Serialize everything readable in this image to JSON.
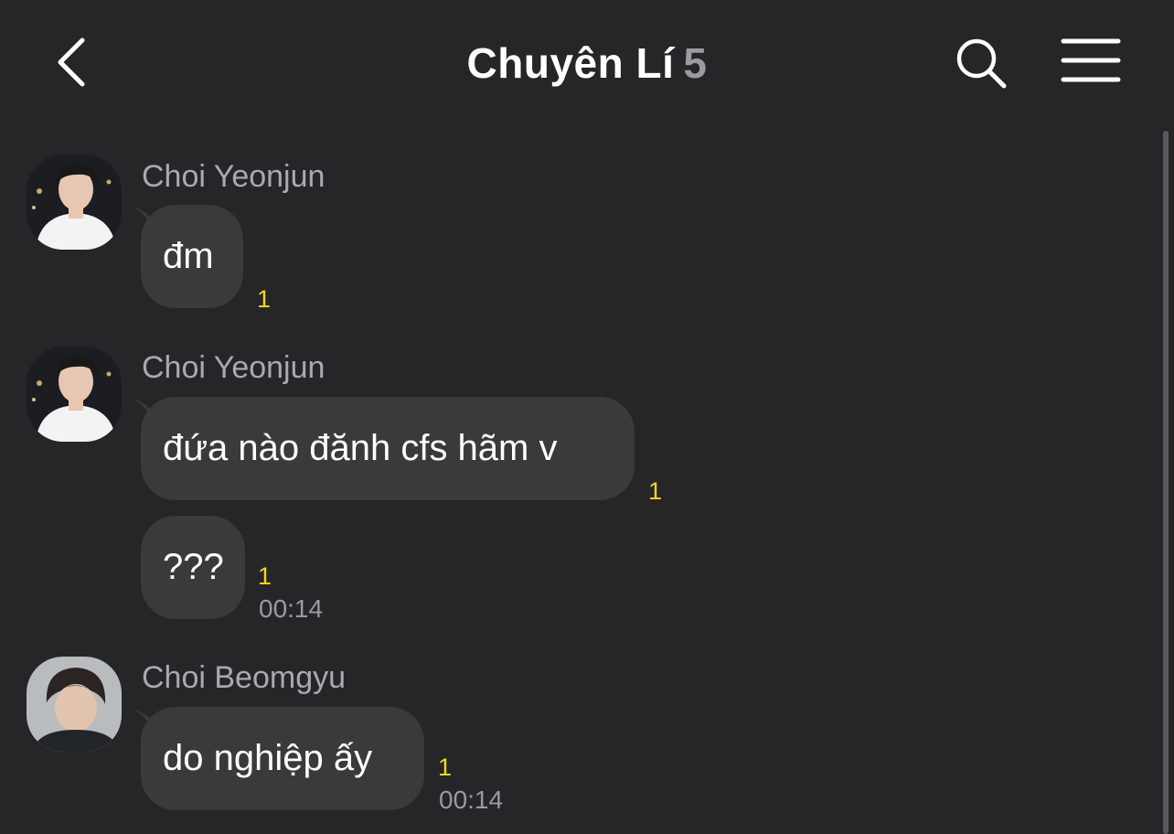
{
  "header": {
    "title": "Chuyên Lí",
    "member_count": "5"
  },
  "messages": [
    {
      "sender": "Choi Yeonjun",
      "text": "đm",
      "unread": "1",
      "time": ""
    },
    {
      "sender": "Choi Yeonjun",
      "text": "đứa nào đănh cfs hãm v",
      "unread": "1",
      "time": ""
    },
    {
      "sender": "",
      "text": "???",
      "unread": "1",
      "time": "00:14"
    },
    {
      "sender": "Choi Beomgyu",
      "text": "do nghiệp ấy",
      "unread": "1",
      "time": "00:14"
    }
  ],
  "icons": {
    "back": "back-chevron-icon",
    "search": "search-icon",
    "menu": "hamburger-menu-icon"
  },
  "colors": {
    "background": "#262629",
    "bubble": "#3a3a3d",
    "unread": "#f5d51b",
    "secondary_text": "#a9a9ae"
  }
}
